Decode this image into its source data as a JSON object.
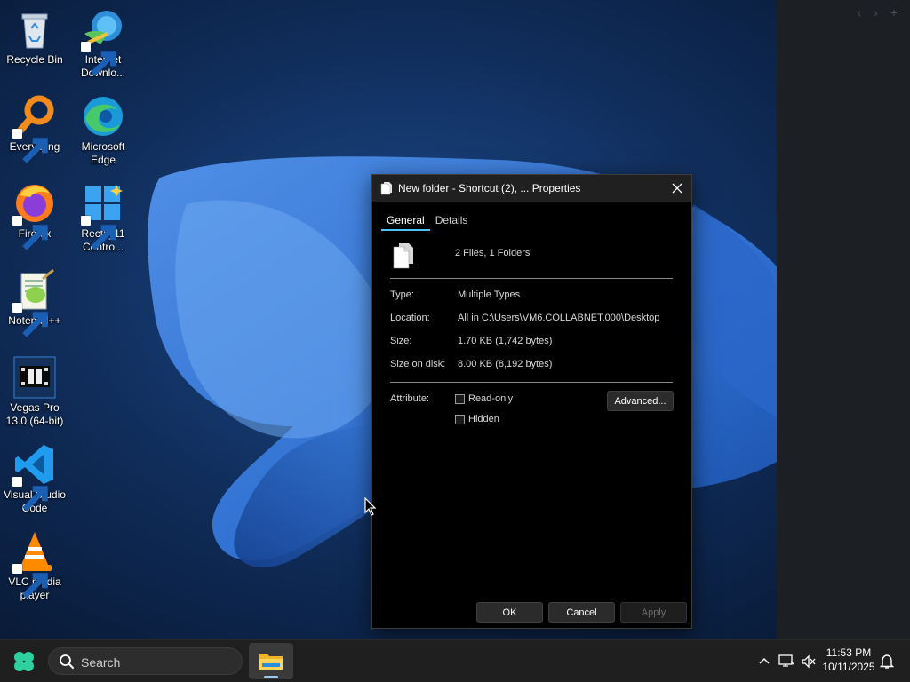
{
  "desktop": {
    "icons": [
      {
        "label": "Recycle Bin",
        "icon": "recycle-bin-icon"
      },
      {
        "label": "Internet Downlo...",
        "icon": "internet-download-manager-icon"
      },
      {
        "label": "Everything",
        "icon": "everything-search-icon"
      },
      {
        "label": "Microsoft Edge",
        "icon": "edge-icon"
      },
      {
        "label": "Firefox",
        "icon": "firefox-icon"
      },
      {
        "label": "Rectify11 Contro...",
        "icon": "rectify11-icon"
      },
      {
        "label": "Notepad++",
        "icon": "notepad-plus-plus-icon"
      },
      {
        "label": "Vegas Pro 13.0 (64-bit)",
        "icon": "vegas-pro-icon"
      },
      {
        "label": "Visual Studio Code",
        "icon": "vscode-icon"
      },
      {
        "label": "VLC media player",
        "icon": "vlc-icon"
      }
    ]
  },
  "right_panel": {
    "nav": [
      "‹",
      "›",
      "+"
    ]
  },
  "dialog": {
    "title": "New folder - Shortcut (2), ... Properties",
    "tabs": [
      {
        "label": "General",
        "active": true
      },
      {
        "label": "Details",
        "active": false
      }
    ],
    "summary": "2 Files, 1 Folders",
    "rows": [
      {
        "label": "Type:",
        "value": "Multiple Types"
      },
      {
        "label": "Location:",
        "value": "All in C:\\Users\\VM6.COLLABNET.000\\Desktop"
      },
      {
        "label": "Size:",
        "value": "1.70 KB (1,742 bytes)"
      },
      {
        "label": "Size on disk:",
        "value": "8.00 KB (8,192 bytes)"
      }
    ],
    "attribute_label": "Attribute:",
    "attributes": [
      {
        "label": "Read-only",
        "checked": false
      },
      {
        "label": "Hidden",
        "checked": false
      }
    ],
    "advanced_label": "Advanced...",
    "ok_label": "OK",
    "cancel_label": "Cancel",
    "apply_label": "Apply"
  },
  "taskbar": {
    "search_placeholder": "Search",
    "time": "11:53 PM",
    "date": "10/11/2025"
  },
  "colors": {
    "accent": "#4cc2ff",
    "taskbar": "#1f1f1f",
    "dialog_bg": "#000000"
  }
}
